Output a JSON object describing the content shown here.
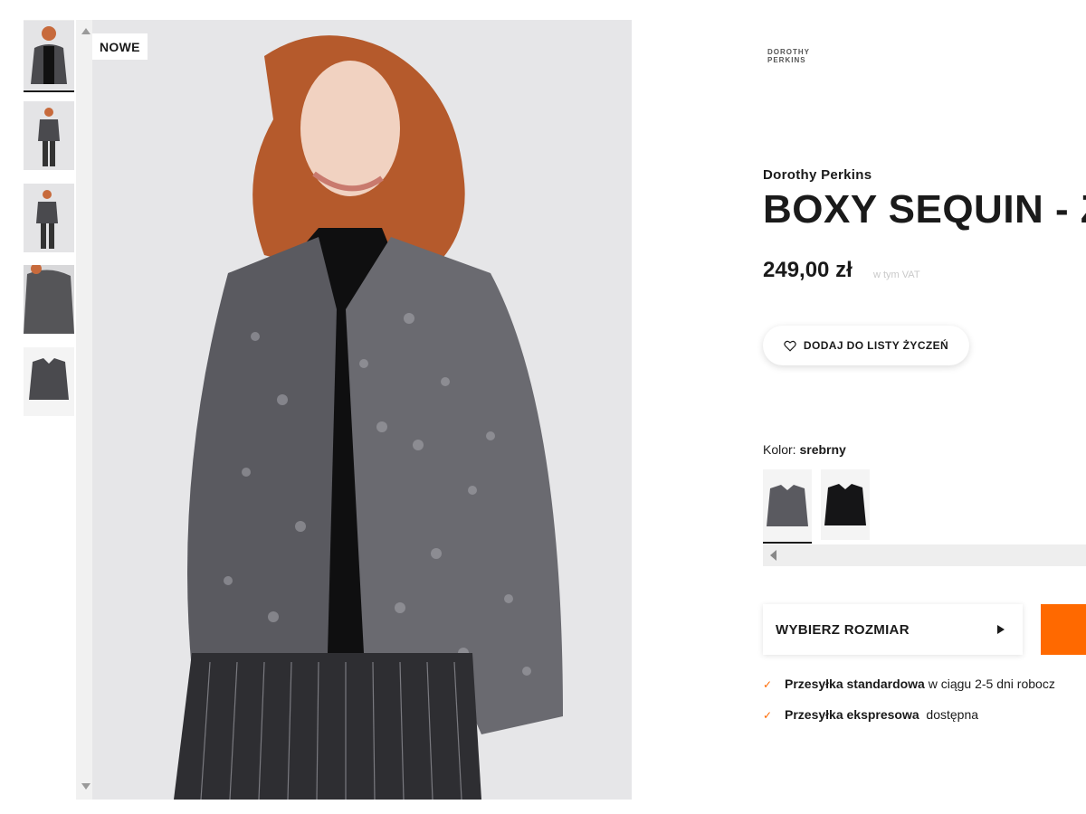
{
  "gallery": {
    "badge": "NOWE",
    "thumbnails": [
      "thumb-front",
      "thumb-full-front",
      "thumb-full-side",
      "thumb-detail",
      "thumb-packshot"
    ]
  },
  "product": {
    "logo_lines": [
      "DOROTHY",
      "PERKINS"
    ],
    "brand": "Dorothy Perkins",
    "title": "BOXY SEQUIN - Z",
    "price": "249,00 zł",
    "vat_note": "w tym VAT",
    "wishlist_label": "DODAJ DO LISTY ŻYCZEŃ",
    "color_label": "Kolor:",
    "color_value": "srebrny",
    "size_label": "WYBIERZ ROZMIAR"
  },
  "shipping": {
    "standard_label": "Przesyłka standardowa",
    "standard_text": " w ciągu 2-5 dni robocz",
    "express_label": "Przesyłka ekspresowa",
    "express_text": "  dostępna"
  },
  "icons": {
    "wishlist": "heart-icon",
    "check": "check-icon",
    "size_arrow": "caret-right-icon",
    "scroll_up": "caret-up-icon",
    "scroll_down": "caret-down-icon"
  },
  "colors": {
    "accent": "#ff6900",
    "text": "#1a1a1a",
    "muted": "#c9c9c9"
  }
}
